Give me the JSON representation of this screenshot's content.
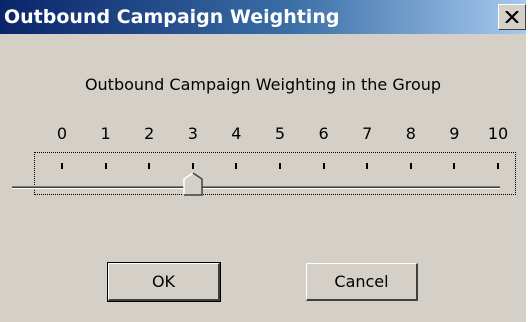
{
  "window": {
    "title": "Outbound Campaign Weighting",
    "close_symbol": "X"
  },
  "dialog": {
    "heading": "Outbound Campaign Weighting in the Group"
  },
  "slider": {
    "min": 0,
    "max": 10,
    "value": 3,
    "tick_labels": [
      "0",
      "1",
      "2",
      "3",
      "4",
      "5",
      "6",
      "7",
      "8",
      "9",
      "10"
    ]
  },
  "buttons": {
    "ok_label": "OK",
    "cancel_label": "Cancel"
  },
  "colors": {
    "dialog_background": "#d4d0c8",
    "titlebar_start": "#0a246a",
    "titlebar_end": "#a6caf0",
    "title_text": "#ffffff"
  },
  "icons": {
    "close": "close-icon",
    "slider_thumb": "slider-thumb"
  }
}
